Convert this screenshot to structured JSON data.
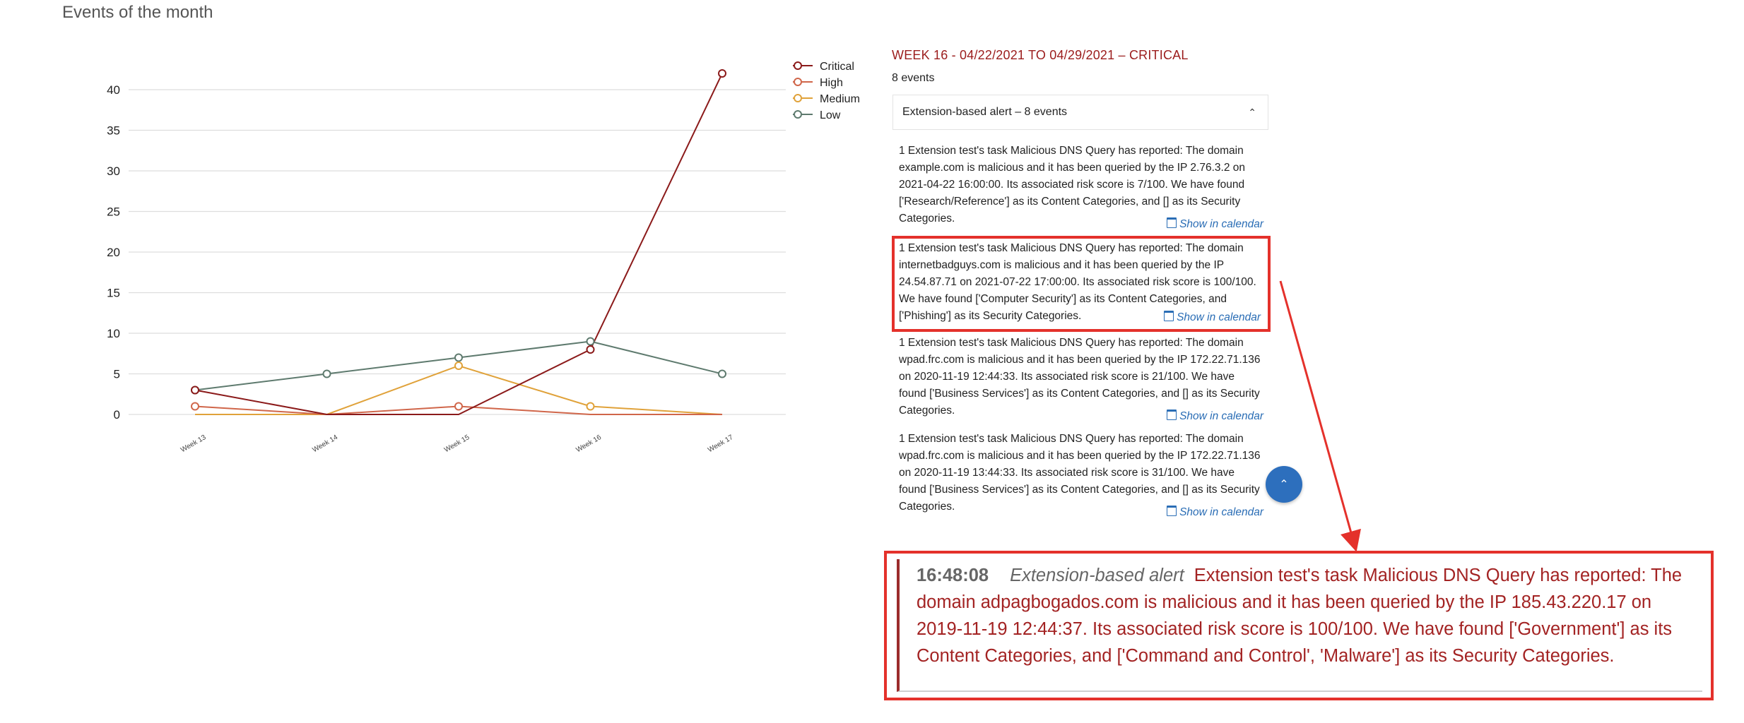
{
  "page": {
    "title": "Events of the month"
  },
  "chart_data": {
    "type": "line",
    "x": [
      "Week 13",
      "Week 14",
      "Week 15",
      "Week 16",
      "Week 17"
    ],
    "series": [
      {
        "name": "Critical",
        "color": "#8b1a1a",
        "values": [
          3,
          0,
          0,
          8,
          42
        ]
      },
      {
        "name": "High",
        "color": "#d0664a",
        "values": [
          1,
          0,
          1,
          0,
          0
        ]
      },
      {
        "name": "Medium",
        "color": "#e0a23a",
        "values": [
          0,
          0,
          6,
          1,
          0
        ]
      },
      {
        "name": "Low",
        "color": "#5e7a6e",
        "values": [
          3,
          5,
          7,
          9,
          5
        ]
      }
    ],
    "yticks": [
      0,
      5,
      10,
      15,
      20,
      25,
      30,
      35,
      40
    ],
    "ylim": [
      0,
      42
    ],
    "grid": true,
    "legend": "top-right"
  },
  "panel": {
    "week_title": "WEEK 16 - 04/22/2021 TO 04/29/2021 – CRITICAL",
    "events_count": "8 events",
    "accordion_label": "Extension-based alert – 8 events",
    "accordion_icon": "chevron-up-icon",
    "events": [
      {
        "text": "1 Extension test's task Malicious DNS Query has reported: The domain example.com is malicious and it has been queried by the IP 2.76.3.2 on 2021-04-22 16:00:00. Its associated risk score is 7/100. We have found ['Research/Reference'] as its Content Categories, and [] as its Security Categories.",
        "link": "Show in calendar",
        "highlighted": false
      },
      {
        "text": "1 Extension test's task Malicious DNS Query has reported: The domain internetbadguys.com is malicious and it has been queried by the IP 24.54.87.71 on 2021-07-22 17:00:00. Its associated risk score is 100/100. We have found ['Computer Security'] as its Content Categories, and ['Phishing'] as its Security Categories.",
        "link": "Show in calendar",
        "highlighted": true
      },
      {
        "text": "1 Extension test's task Malicious DNS Query has reported: The domain wpad.frc.com is malicious and it has been queried by the IP 172.22.71.136 on 2020-11-19 12:44:33. Its associated risk score is 21/100. We have found ['Business Services'] as its Content Categories, and [] as its Security Categories.",
        "link": "Show in calendar",
        "highlighted": false
      },
      {
        "text": "1 Extension test's task Malicious DNS Query has reported: The domain wpad.frc.com is malicious and it has been queried by the IP 172.22.71.136 on 2020-11-19 13:44:33. Its associated risk score is 31/100. We have found ['Business Services'] as its Content Categories, and [] as its Security Categories.",
        "link": "Show in calendar",
        "highlighted": false
      }
    ]
  },
  "scroll_top": {
    "icon": "chevron-up-icon",
    "glyph": "⌃"
  },
  "zoom": {
    "time": "16:48:08",
    "type": "Extension-based alert",
    "text": "Extension test's task Malicious DNS Query has reported: The domain adpagbogados.com is malicious and it has been queried by the IP 185.43.220.17 on 2019-11-19 12:44:37. Its associated risk score is 100/100. We have found ['Government'] as its Content Categories, and ['Command and Control', 'Malware'] as its Security Categories."
  },
  "colors": {
    "accent_red": "#e4312b",
    "title_red": "#9b1c1c",
    "link_blue": "#2a6db5",
    "button_blue": "#2d6fbd"
  }
}
